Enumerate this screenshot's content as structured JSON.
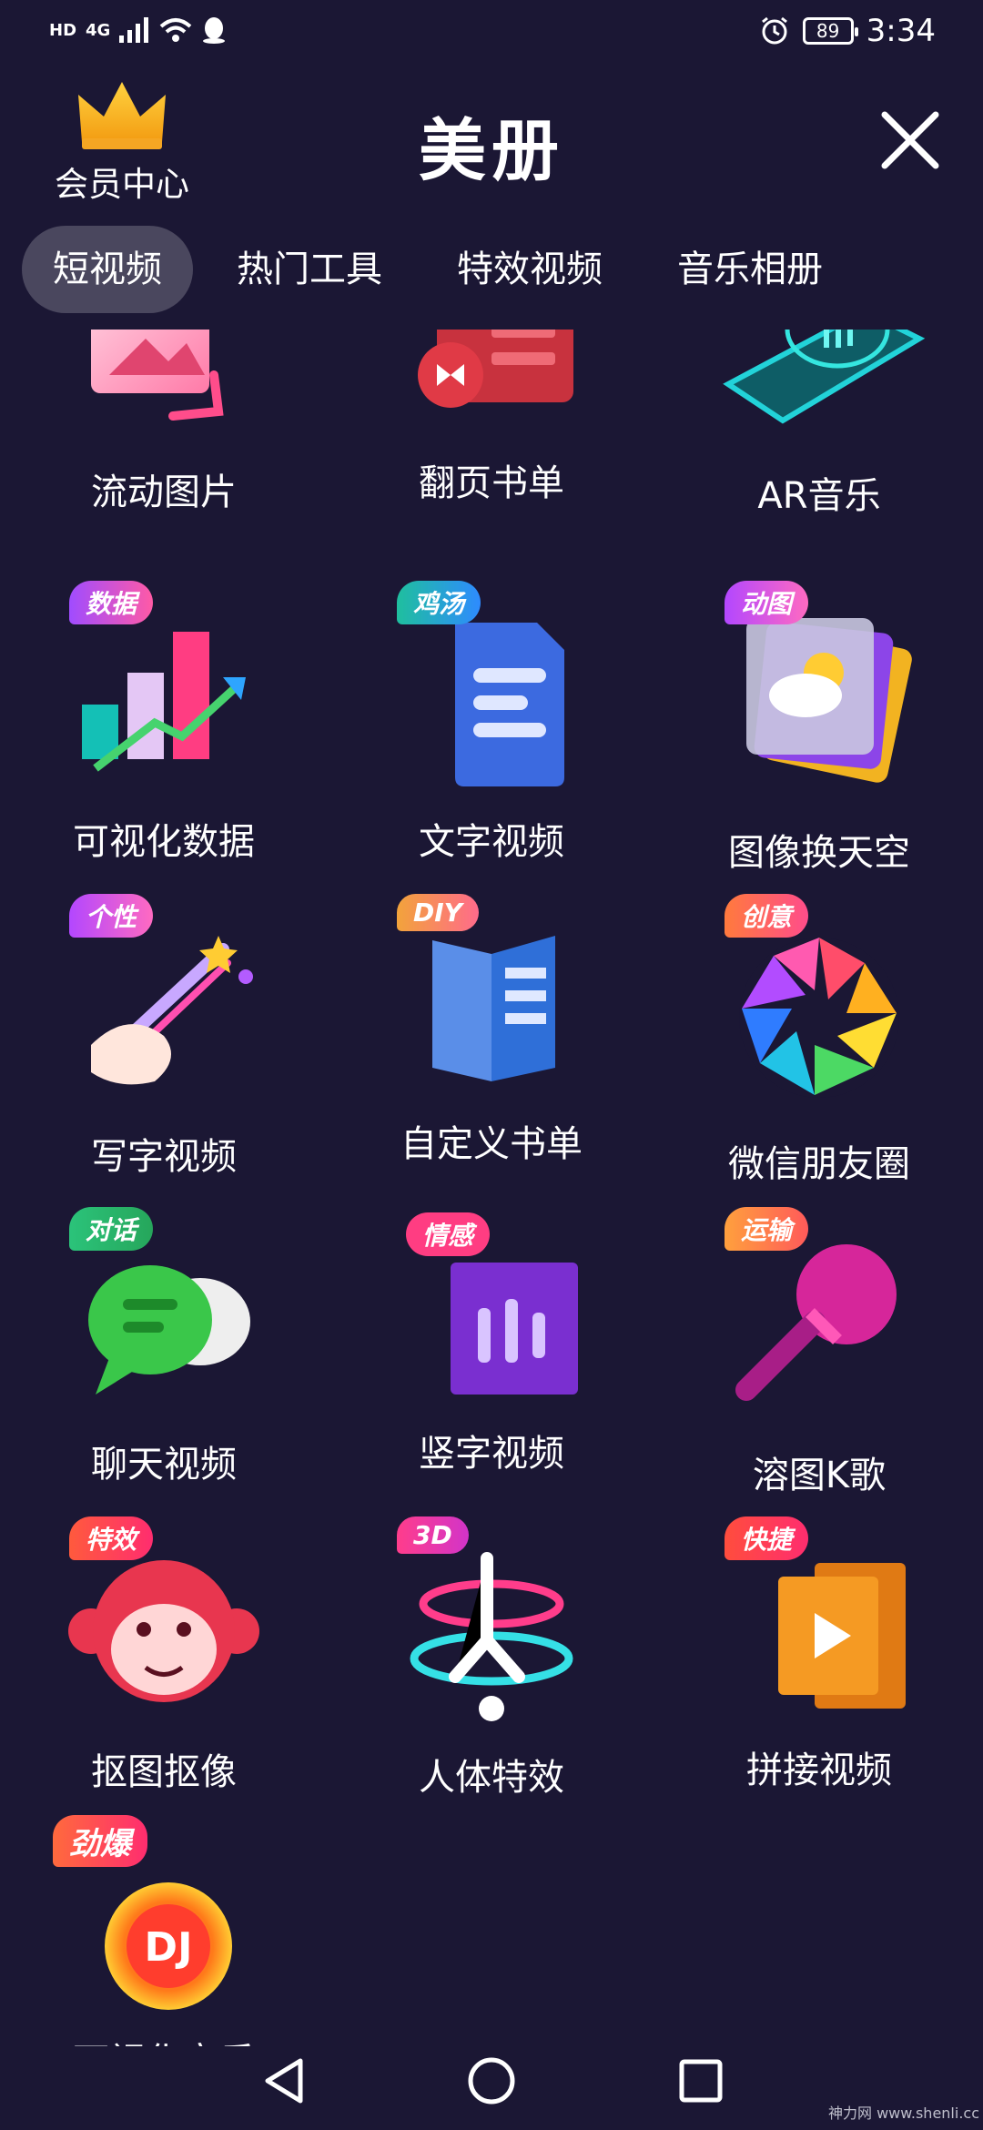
{
  "status_bar": {
    "hd": "HD",
    "network": "4G",
    "battery": "89",
    "time": "3:34"
  },
  "header": {
    "vip_label": "会员中心",
    "title": "美册"
  },
  "tabs": [
    {
      "label": "短视频",
      "active": true
    },
    {
      "label": "热门工具",
      "active": false
    },
    {
      "label": "特效视频",
      "active": false
    },
    {
      "label": "音乐相册",
      "active": false
    }
  ],
  "items": [
    {
      "label": "流动图片",
      "icon": "flowing-image-icon"
    },
    {
      "label": "翻页书单",
      "icon": "flip-booklist-icon"
    },
    {
      "label": "AR音乐",
      "icon": "ar-music-icon"
    },
    {
      "label": "可视化数据",
      "badge": "数据",
      "icon": "bar-chart-icon"
    },
    {
      "label": "文字视频",
      "badge": "鸡汤",
      "icon": "document-icon"
    },
    {
      "label": "图像换天空",
      "badge": "动图",
      "icon": "weather-photo-icon"
    },
    {
      "label": "写字视频",
      "badge": "个性",
      "icon": "writing-hand-icon"
    },
    {
      "label": "自定义书单",
      "badge": "DIY",
      "icon": "open-book-icon"
    },
    {
      "label": "微信朋友圈",
      "badge": "创意",
      "icon": "camera-aperture-icon"
    },
    {
      "label": "聊天视频",
      "badge": "对话",
      "icon": "chat-bubble-icon"
    },
    {
      "label": "竖字视频",
      "badge": "情感",
      "icon": "vertical-text-icon"
    },
    {
      "label": "溶图K歌",
      "badge": "运输",
      "icon": "microphone-icon"
    },
    {
      "label": "抠图抠像",
      "badge": "特效",
      "icon": "monkey-face-icon"
    },
    {
      "label": "人体特效",
      "badge": "3D",
      "icon": "body-effect-icon"
    },
    {
      "label": "拼接视频",
      "badge": "快捷",
      "icon": "video-splice-icon"
    },
    {
      "label": "可视化音乐",
      "badge": "劲爆",
      "icon": "dj-icon"
    }
  ],
  "watermark": "神力网 www.shenli.cc",
  "colors": {
    "background": "#1b1734",
    "tab_active": "#4a475e"
  }
}
